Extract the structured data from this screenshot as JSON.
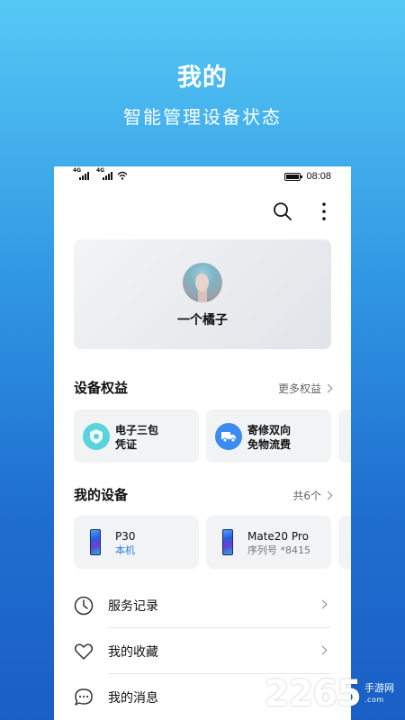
{
  "promo": {
    "title": "我的",
    "subtitle": "智能管理设备状态"
  },
  "status_bar": {
    "signal_1": "4G",
    "signal_2": "4G",
    "time": "08:08"
  },
  "topbar": {
    "icons": [
      "search-icon",
      "more-vertical-icon"
    ]
  },
  "profile": {
    "name": "一个橘子"
  },
  "benefits": {
    "title": "设备权益",
    "more_label": "更多权益",
    "items": [
      {
        "line1": "电子三包",
        "line2": "凭证",
        "icon": "warranty-icon",
        "color": "#4fd0d8"
      },
      {
        "line1": "寄修双向",
        "line2": "免物流费",
        "icon": "truck-icon",
        "color": "#3b8cf0"
      }
    ]
  },
  "devices": {
    "title": "我的设备",
    "count_label": "共6个",
    "items": [
      {
        "name": "P30",
        "sub": "本机",
        "sub_color": "#2a7be4"
      },
      {
        "name": "Mate20 Pro",
        "sub": "序列号 *8415",
        "sub_color": "#777777"
      }
    ]
  },
  "menu": [
    {
      "label": "服务记录",
      "icon": "clock-icon"
    },
    {
      "label": "我的收藏",
      "icon": "heart-icon"
    },
    {
      "label": "我的消息",
      "icon": "message-icon"
    }
  ],
  "watermark": {
    "number": "2265",
    "suffix": "手游网",
    "domain": ".com"
  }
}
